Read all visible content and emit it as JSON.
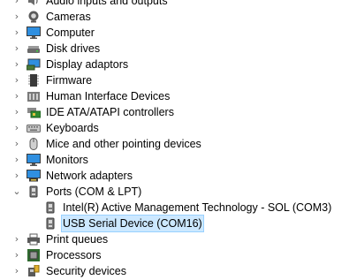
{
  "tree": {
    "items": [
      {
        "label": "Audio inputs and outputs",
        "icon": "speaker-icon",
        "expanded": false
      },
      {
        "label": "Cameras",
        "icon": "camera-icon",
        "expanded": false
      },
      {
        "label": "Computer",
        "icon": "monitor-icon",
        "expanded": false
      },
      {
        "label": "Disk drives",
        "icon": "disk-drive-icon",
        "expanded": false
      },
      {
        "label": "Display adaptors",
        "icon": "display-adapter-icon",
        "expanded": false
      },
      {
        "label": "Firmware",
        "icon": "firmware-chip-icon",
        "expanded": false
      },
      {
        "label": "Human Interface Devices",
        "icon": "hid-icon",
        "expanded": false
      },
      {
        "label": "IDE ATA/ATAPI controllers",
        "icon": "ide-controller-icon",
        "expanded": false
      },
      {
        "label": "Keyboards",
        "icon": "keyboard-icon",
        "expanded": false
      },
      {
        "label": "Mice and other pointing devices",
        "icon": "mouse-icon",
        "expanded": false
      },
      {
        "label": "Monitors",
        "icon": "monitor-icon",
        "expanded": false
      },
      {
        "label": "Network adapters",
        "icon": "network-adapter-icon",
        "expanded": false
      },
      {
        "label": "Ports (COM & LPT)",
        "icon": "port-icon",
        "expanded": true,
        "children": [
          {
            "label": "Intel(R) Active Management Technology - SOL (COM3)",
            "icon": "port-icon"
          },
          {
            "label": "USB Serial Device (COM16)",
            "icon": "port-icon",
            "selected": true
          }
        ]
      },
      {
        "label": "Print queues",
        "icon": "printer-icon",
        "expanded": false
      },
      {
        "label": "Processors",
        "icon": "processor-icon",
        "expanded": false
      },
      {
        "label": "Security devices",
        "icon": "security-device-icon",
        "expanded": false
      }
    ]
  },
  "colors": {
    "selection": "#cce8ff",
    "selection_border": "#99d1ff"
  }
}
